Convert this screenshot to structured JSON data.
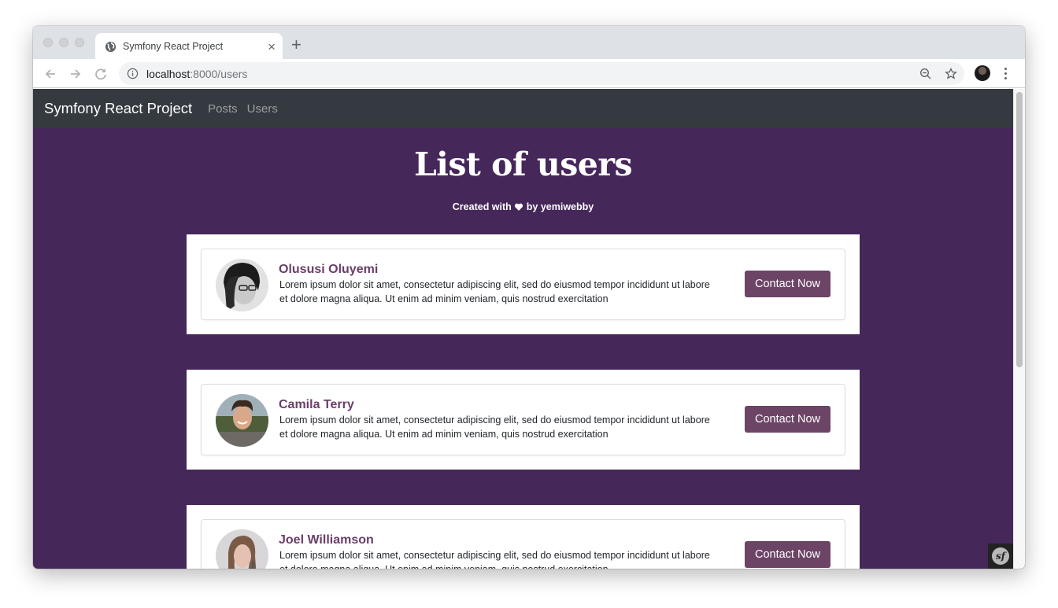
{
  "browser": {
    "tab_title": "Symfony React Project",
    "new_tab_label": "+",
    "close_tab_label": "×",
    "url_host": "localhost",
    "url_rest": ":8000/users"
  },
  "navbar": {
    "brand": "Symfony React Project",
    "links": [
      {
        "label": "Posts"
      },
      {
        "label": "Users"
      }
    ]
  },
  "hero": {
    "title": "List of users",
    "subtitle_prefix": "Created with",
    "subtitle_suffix": "by yemiwebby"
  },
  "users": [
    {
      "name": "Olususi Oluyemi",
      "bio": "Lorem ipsum dolor sit amet, consectetur adipiscing elit, sed do eiusmod tempor incididunt ut labore et dolore magna aliqua. Ut enim ad minim veniam, quis nostrud exercitation",
      "button": "Contact Now"
    },
    {
      "name": "Camila Terry",
      "bio": "Lorem ipsum dolor sit amet, consectetur adipiscing elit, sed do eiusmod tempor incididunt ut labore et dolore magna aliqua. Ut enim ad minim veniam, quis nostrud exercitation",
      "button": "Contact Now"
    },
    {
      "name": "Joel Williamson",
      "bio": "Lorem ipsum dolor sit amet, consectetur adipiscing elit, sed do eiusmod tempor incididunt ut labore et dolore magna aliqua. Ut enim ad minim veniam, quis nostrud exercitation",
      "button": "Contact Now"
    }
  ],
  "debug_toolbar": {
    "logo_text": "sf"
  },
  "colors": {
    "page_bg": "#45275a",
    "navbar_bg": "#343a40",
    "accent": "#6c4466",
    "name_color": "#6a3e68"
  }
}
